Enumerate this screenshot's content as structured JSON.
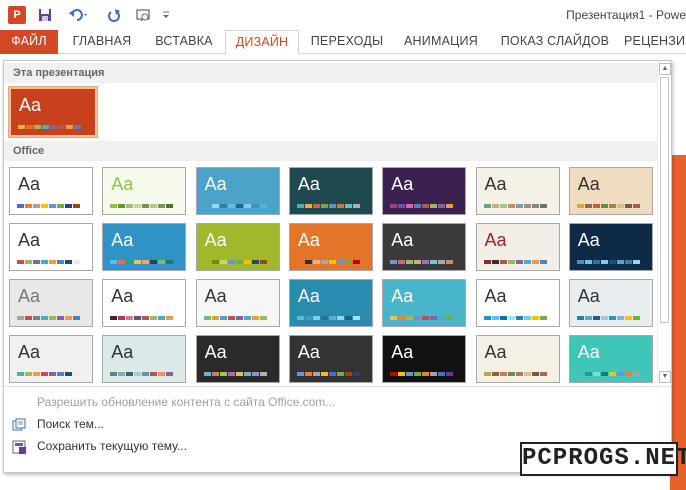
{
  "app": {
    "icon_label": "P",
    "title": "Презентация1 - Powe"
  },
  "tabs": [
    "ФАЙЛ",
    "ГЛАВНАЯ",
    "ВСТАВКА",
    "ДИЗАЙН",
    "ПЕРЕХОДЫ",
    "АНИМАЦИЯ",
    "ПОКАЗ СЛАЙДОВ",
    "РЕЦЕНЗИ"
  ],
  "active_tab": "ДИЗАЙН",
  "accent": "#d24726",
  "gallery": {
    "section_this": "Эта презентация",
    "section_office": "Office",
    "current_theme": {
      "aa": "Aa",
      "bg": "#c8401c",
      "fg": "#ffffff",
      "sw": [
        "#f3b23a",
        "#e86c2c",
        "#9bbb59",
        "#4bacc6",
        "#8064a2",
        "#c0504d",
        "#f79646",
        "#4f81bd"
      ]
    },
    "themes": [
      {
        "aa": "Aa",
        "bg": "#ffffff",
        "fg": "#333333",
        "sw": [
          "#4472c4",
          "#ed7d31",
          "#a5a5a5",
          "#ffc000",
          "#5b9bd5",
          "#70ad47",
          "#264478",
          "#9e480e"
        ]
      },
      {
        "aa": "Aa",
        "bg": "#f7fbee",
        "fg": "#8dc63f",
        "sw": [
          "#8dc63f",
          "#5a9e2f",
          "#a3c16b",
          "#c6d98b",
          "#6f9a3b",
          "#b3cf6f",
          "#809c3a",
          "#4b7a24"
        ]
      },
      {
        "aa": "Aa",
        "bg": "#4aa3c9",
        "fg": "#ffffff",
        "sw": [
          "#4aa3c9",
          "#a6d3e6",
          "#2e7fa7",
          "#6bb9d8",
          "#1f6688",
          "#8cc8e0",
          "#3c93bb",
          "#5fb0d4"
        ]
      },
      {
        "aa": "Aa",
        "bg": "#1c4a4e",
        "fg": "#ffffff",
        "sw": [
          "#4ab0a8",
          "#e6b04a",
          "#d45d46",
          "#8a9a4b",
          "#6a8fbf",
          "#c97b3f",
          "#7ab8b0",
          "#b0b0b0"
        ]
      },
      {
        "aa": "Aa",
        "bg": "#3b2150",
        "fg": "#ffffff",
        "sw": [
          "#b23a7a",
          "#7b4ab5",
          "#e0649e",
          "#4f81bd",
          "#c0504d",
          "#9bbb59",
          "#8064a2",
          "#f79646"
        ]
      },
      {
        "aa": "Aa",
        "bg": "#f4f2e6",
        "fg": "#333333",
        "sw": [
          "#6fa08f",
          "#c6b56a",
          "#a8c28b",
          "#d38b59",
          "#7e9eb8",
          "#b07fa6",
          "#8a8a6a",
          "#5c7a6b"
        ]
      },
      {
        "aa": "Aa",
        "bg": "#f0dcc0",
        "fg": "#333333",
        "sw": [
          "#e3a33b",
          "#8c6b4a",
          "#c35f35",
          "#6b8a4a",
          "#a88050",
          "#d4c07a",
          "#7a5b3a",
          "#b0584a"
        ]
      },
      {
        "aa": "Aa",
        "bg": "#ffffff",
        "fg": "#333333",
        "sw": [
          "#c0504d",
          "#9bbb59",
          "#8064a2",
          "#4bacc6",
          "#f79646",
          "#4f81bd",
          "#1f497d",
          "#eeece1"
        ]
      },
      {
        "aa": "Aa",
        "bg": "#2f93c6",
        "fg": "#ffffff",
        "sw": [
          "#5bc0de",
          "#e76f51",
          "#2a9d8f",
          "#e9c46a",
          "#f4a261",
          "#264653",
          "#8ab17d",
          "#287271"
        ]
      },
      {
        "aa": "Aa",
        "bg": "#a2b82b",
        "fg": "#ffffff",
        "sw": [
          "#a2b82b",
          "#6e8a1e",
          "#c8d86b",
          "#5b9bd5",
          "#70ad47",
          "#ffc000",
          "#264478",
          "#9e480e"
        ]
      },
      {
        "aa": "Aa",
        "bg": "#e2752a",
        "fg": "#ffffff",
        "sw": [
          "#e2752a",
          "#333333",
          "#f4b183",
          "#a5a5a5",
          "#ffc000",
          "#5b9bd5",
          "#70ad47",
          "#c00000"
        ]
      },
      {
        "aa": "Aa",
        "bg": "#3a3a3a",
        "fg": "#ffffff",
        "sw": [
          "#6a9bd0",
          "#d06a6a",
          "#90c06a",
          "#d0b06a",
          "#a06ad0",
          "#6ad0c0",
          "#aaaaaa",
          "#d08a6a"
        ]
      },
      {
        "aa": "Aa",
        "bg": "#f3efe8",
        "fg": "#a61e22",
        "sw": [
          "#a61e22",
          "#333333",
          "#c0504d",
          "#9bbb59",
          "#8064a2",
          "#4bacc6",
          "#f79646",
          "#4f81bd"
        ]
      },
      {
        "aa": "Aa",
        "bg": "#0f2a47",
        "fg": "#ffffff",
        "sw": [
          "#4a90c8",
          "#6fbfe0",
          "#2f6fa8",
          "#8cc8e8",
          "#1f4f7f",
          "#5fa0d0",
          "#3a7fb8",
          "#a0d0f0"
        ]
      },
      {
        "aa": "Aa",
        "bg": "#e8e8e8",
        "fg": "#777777",
        "sw": [
          "#a5a5a5",
          "#c0504d",
          "#7f7f7f",
          "#4bacc6",
          "#9bbb59",
          "#8064a2",
          "#f79646",
          "#4f81bd"
        ]
      },
      {
        "aa": "Aa",
        "bg": "#ffffff",
        "fg": "#333333",
        "sw": [
          "#5b1a2b",
          "#a83a5a",
          "#d07a8a",
          "#6b4a8a",
          "#c0504d",
          "#9bbb59",
          "#4bacc6",
          "#f79646"
        ]
      },
      {
        "aa": "Aa",
        "bg": "#f6f6f6",
        "fg": "#333333",
        "sw": [
          "#6fbf73",
          "#e0a04a",
          "#5b9bd5",
          "#c0504d",
          "#8064a2",
          "#4bacc6",
          "#f79646",
          "#9bbb59"
        ]
      },
      {
        "aa": "Aa",
        "bg": "#2a8bb0",
        "fg": "#ffffff",
        "sw": [
          "#4fc0d8",
          "#3aa0c0",
          "#7fd0e0",
          "#2a7090",
          "#5ab0c8",
          "#8fd8e8",
          "#1f6080",
          "#a0e0f0"
        ]
      },
      {
        "aa": "Aa",
        "bg": "#49b5c8",
        "fg": "#ffffff",
        "sw": [
          "#e5c45a",
          "#d98a3a",
          "#9bbb59",
          "#5b9bd5",
          "#c0504d",
          "#8064a2",
          "#4bacc6",
          "#70ad47"
        ]
      },
      {
        "aa": "Aa",
        "bg": "#ffffff",
        "fg": "#333333",
        "sw": [
          "#1e90d8",
          "#5bc0eb",
          "#0f6fa8",
          "#a8dcf5",
          "#2a7fc0",
          "#7fc8f0",
          "#ffc000",
          "#70ad47"
        ]
      },
      {
        "aa": "Aa",
        "bg": "#e8edf0",
        "fg": "#333333",
        "sw": [
          "#2a7f9f",
          "#5fa8c0",
          "#1f5f7f",
          "#9fc8d8",
          "#3a90b0",
          "#7fb8d0",
          "#ffc000",
          "#70ad47"
        ]
      },
      {
        "aa": "Aa",
        "bg": "#f0f0f0",
        "fg": "#333333",
        "sw": [
          "#4bacc6",
          "#9bbb59",
          "#f79646",
          "#c0504d",
          "#8064a2",
          "#4f81bd",
          "#1f497d",
          "#eeece1"
        ]
      },
      {
        "aa": "Aa",
        "bg": "#dbe9e8",
        "fg": "#333333",
        "sw": [
          "#4a8a88",
          "#7fb0ae",
          "#2f6a68",
          "#a8d0ce",
          "#5a9a98",
          "#c0504d",
          "#f79646",
          "#8064a2"
        ]
      },
      {
        "aa": "Aa",
        "bg": "#2a2a2a",
        "fg": "#ffffff",
        "sw": [
          "#6fb0d8",
          "#d08050",
          "#a0c060",
          "#c060a0",
          "#e0c050",
          "#60c0b0",
          "#9090d0",
          "#b0b0b0"
        ]
      },
      {
        "aa": "Aa",
        "bg": "#333333",
        "fg": "#ffffff",
        "sw": [
          "#5a9bd5",
          "#ed7d31",
          "#a5a5a5",
          "#ffc000",
          "#4472c4",
          "#70ad47",
          "#9e480e",
          "#264478"
        ]
      },
      {
        "aa": "Aa",
        "bg": "#111111",
        "fg": "#ffffff",
        "sw": [
          "#c00000",
          "#ffc000",
          "#5b9bd5",
          "#70ad47",
          "#ed7d31",
          "#a5a5a5",
          "#4472c4",
          "#7030a0"
        ]
      },
      {
        "aa": "Aa",
        "bg": "#f4f0e6",
        "fg": "#333333",
        "sw": [
          "#c9a24a",
          "#8a6a3a",
          "#d07a4a",
          "#6a8a5a",
          "#a08060",
          "#e0c080",
          "#7a5a3a",
          "#b06a4a"
        ]
      },
      {
        "aa": "Aa",
        "bg": "#3fc6b8",
        "fg": "#ffffff",
        "sw": [
          "#3fc6b8",
          "#2a9a8e",
          "#7fdcd2",
          "#1f7a70",
          "#ffc000",
          "#5b9bd5",
          "#ed7d31",
          "#a5a5a5"
        ]
      }
    ]
  },
  "commands": {
    "enable_updates": "Разрешить обновление контента с сайта Office.com...",
    "browse": "Поиск тем...",
    "save_theme": "Сохранить текущую тему..."
  },
  "watermark": "PCPROGS.NET"
}
